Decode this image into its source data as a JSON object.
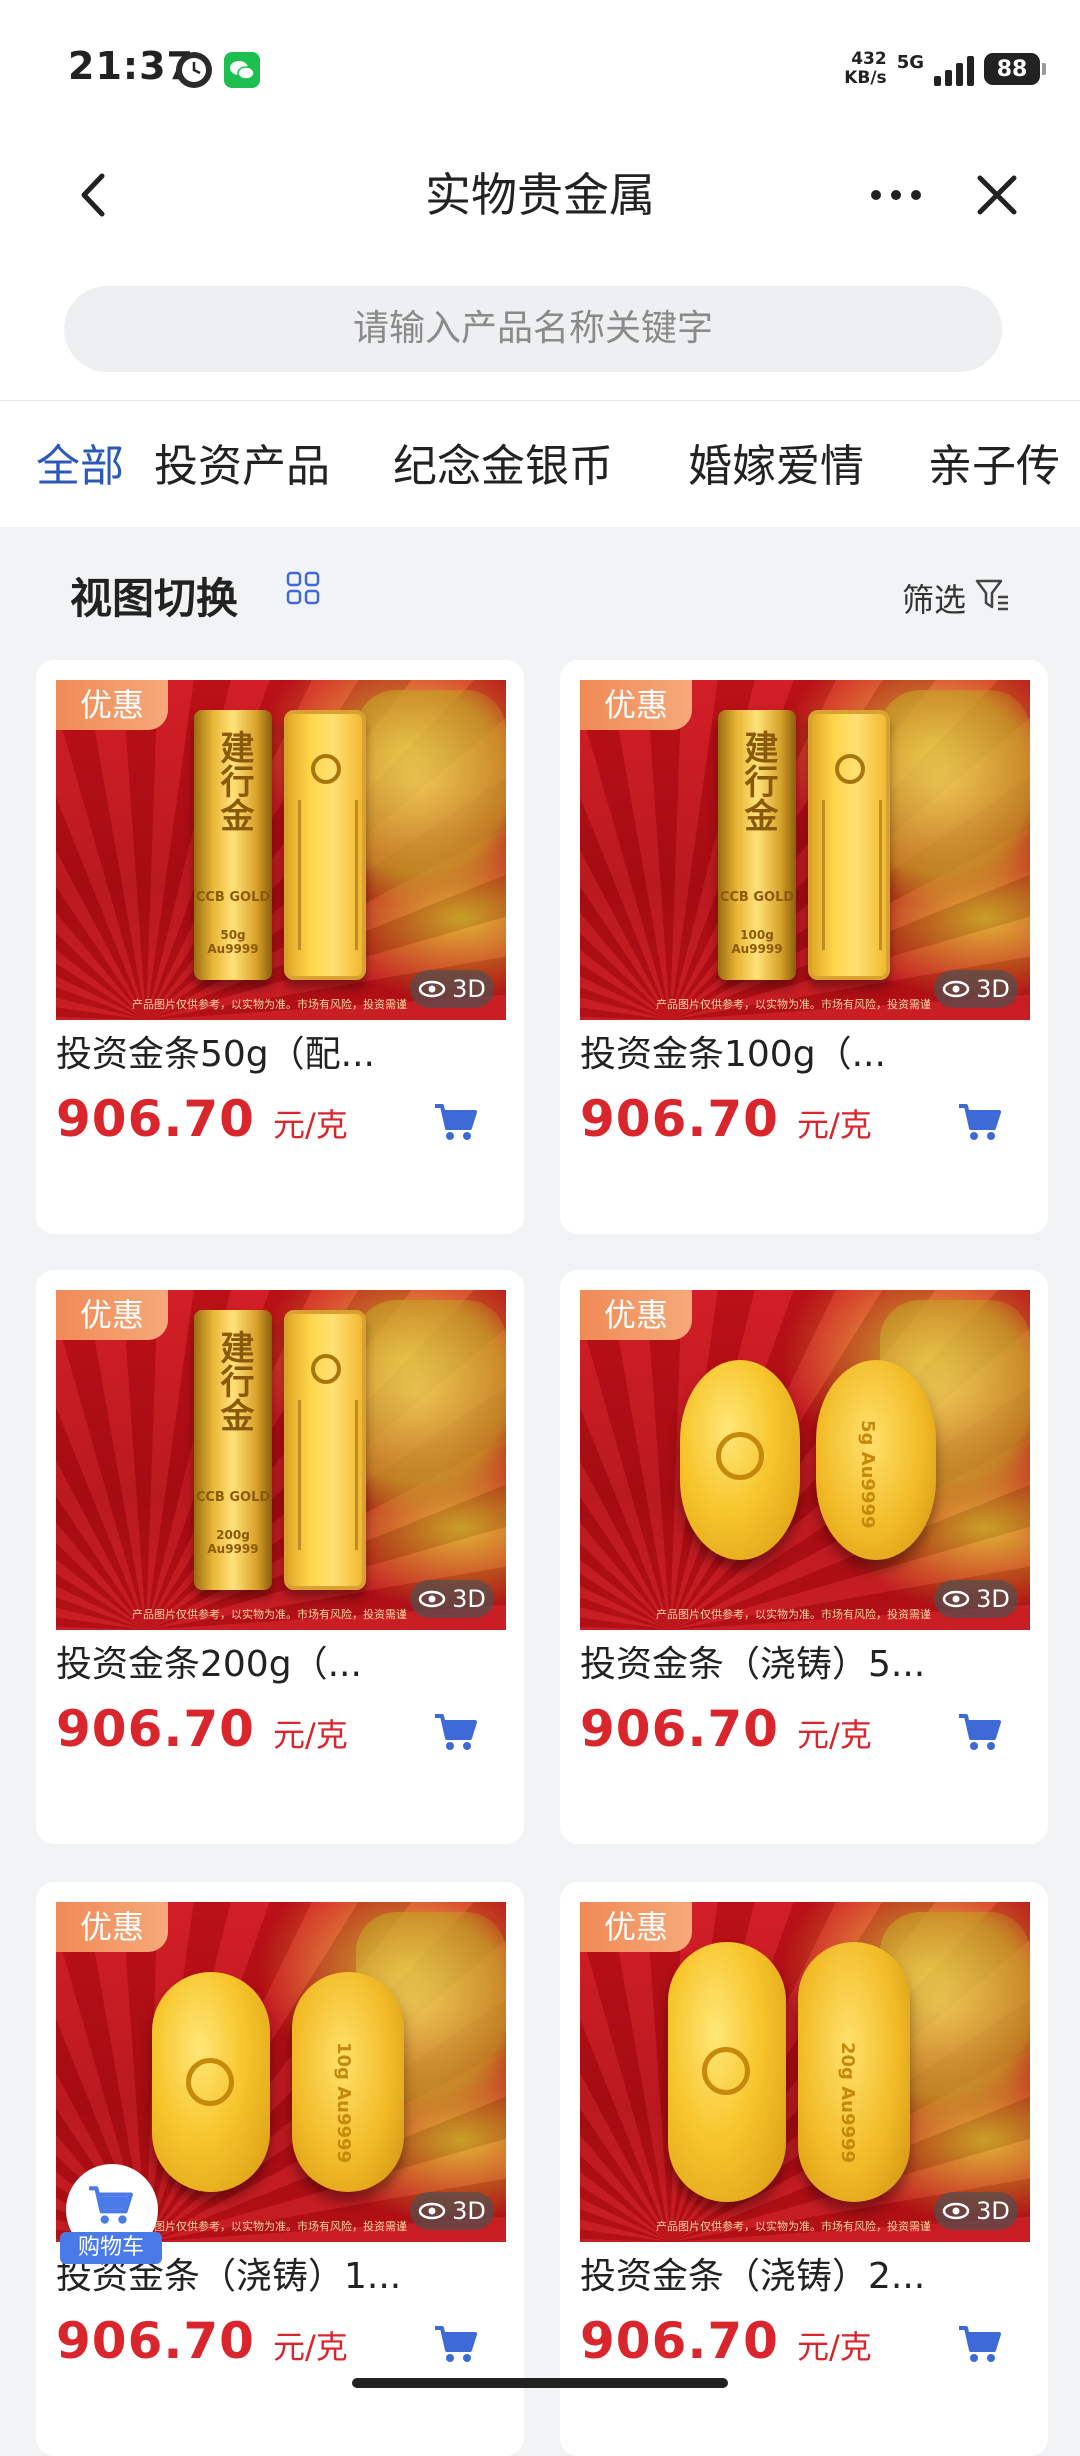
{
  "status_bar": {
    "time": "21:37",
    "net_speed_value": "432",
    "net_speed_unit": "KB/s",
    "network": "5G",
    "battery": "88",
    "icons": [
      "clock-app-icon",
      "wechat-icon",
      "signal-icon",
      "battery-icon"
    ]
  },
  "nav": {
    "title": "实物贵金属",
    "icons": [
      "back-icon",
      "more-icon",
      "close-icon"
    ]
  },
  "search": {
    "placeholder": "请输入产品名称关键字"
  },
  "tabs": [
    {
      "label": "全部",
      "active": true
    },
    {
      "label": "投资产品",
      "active": false
    },
    {
      "label": "纪念金银币",
      "active": false
    },
    {
      "label": "婚嫁爱情",
      "active": false
    },
    {
      "label": "亲子传",
      "active": false
    }
  ],
  "toolbar": {
    "view_switch_label": "视图切换",
    "filter_label": "筛选"
  },
  "products": [
    {
      "name": "投资金条50g（配...",
      "price": "906.70",
      "unit": "元/克",
      "badge": "优惠",
      "badge_3d": "3D",
      "bar_text": "建行金",
      "bar_small": "CCB GOLD",
      "bar_weight": "50g Au9999"
    },
    {
      "name": "投资金条100g（...",
      "price": "906.70",
      "unit": "元/克",
      "badge": "优惠",
      "badge_3d": "3D",
      "bar_text": "建行金",
      "bar_small": "CCB GOLD",
      "bar_weight": "100g Au9999"
    },
    {
      "name": "投资金条200g（...",
      "price": "906.70",
      "unit": "元/克",
      "badge": "优惠",
      "badge_3d": "3D",
      "bar_text": "建行金",
      "bar_small": "CCB GOLD",
      "bar_weight": "200g Au9999"
    },
    {
      "name": "投资金条（浇铸）5...",
      "price": "906.70",
      "unit": "元/克",
      "badge": "优惠",
      "badge_3d": "3D",
      "oval_text": "5g Au9999"
    },
    {
      "name": "投资金条（浇铸）1...",
      "price": "906.70",
      "unit": "元/克",
      "badge": "优惠",
      "badge_3d": "3D",
      "oval_text": "10g Au9999"
    },
    {
      "name": "投资金条（浇铸）2...",
      "price": "906.70",
      "unit": "元/克",
      "badge": "优惠",
      "badge_3d": "3D",
      "oval_text": "20g Au9999"
    }
  ],
  "disclaimer": "产品图片仅供参考，以实物为准。市场有风险，投资需谨",
  "floating_cart": {
    "label": "购物车"
  },
  "colors": {
    "accent_blue": "#2c59b8",
    "price_red": "#d9262c",
    "badge_orange": "#f08a56"
  }
}
